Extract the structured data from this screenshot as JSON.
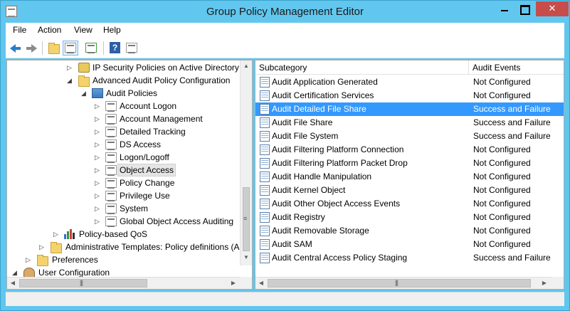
{
  "window": {
    "title": "Group Policy Management Editor",
    "accent_color": "#5fc6ee",
    "close_label": "✕"
  },
  "menubar": {
    "items": [
      {
        "label": "File"
      },
      {
        "label": "Action"
      },
      {
        "label": "View"
      },
      {
        "label": "Help"
      }
    ]
  },
  "toolbar": {
    "buttons": [
      "back-icon",
      "forward-icon",
      "up-folder-icon",
      "show-hide-tree-icon",
      "export-list-icon",
      "help-icon",
      "properties-icon"
    ]
  },
  "tree": {
    "nodes": [
      {
        "label": "IP Security Policies on Active Directory",
        "icon": "lock-icon",
        "toggle": "▷"
      },
      {
        "label": "Advanced Audit Policy Configuration",
        "icon": "folder-icon",
        "toggle": "◢"
      },
      {
        "label": "Audit Policies",
        "icon": "audit-icon",
        "toggle": "◢"
      },
      {
        "label": "Account Logon",
        "icon": "list-icon",
        "toggle": "▷"
      },
      {
        "label": "Account Management",
        "icon": "list-icon",
        "toggle": "▷"
      },
      {
        "label": "Detailed Tracking",
        "icon": "list-icon",
        "toggle": "▷"
      },
      {
        "label": "DS Access",
        "icon": "list-icon",
        "toggle": "▷"
      },
      {
        "label": "Logon/Logoff",
        "icon": "list-icon",
        "toggle": "▷"
      },
      {
        "label": "Object Access",
        "icon": "list-icon",
        "toggle": "▷"
      },
      {
        "label": "Policy Change",
        "icon": "list-icon",
        "toggle": "▷"
      },
      {
        "label": "Privilege Use",
        "icon": "list-icon",
        "toggle": "▷"
      },
      {
        "label": "System",
        "icon": "list-icon",
        "toggle": "▷"
      },
      {
        "label": "Global Object Access Auditing",
        "icon": "list-icon",
        "toggle": "▷"
      },
      {
        "label": "Policy-based QoS",
        "icon": "chart-icon",
        "toggle": "▷"
      },
      {
        "label": "Administrative Templates: Policy definitions (A",
        "icon": "folder-icon",
        "toggle": "▷"
      },
      {
        "label": "Preferences",
        "icon": "folder-icon",
        "toggle": "▷"
      },
      {
        "label": "User Configuration",
        "icon": "user-icon",
        "toggle": "◢"
      }
    ],
    "selected": "Object Access"
  },
  "list": {
    "columns": {
      "subcategory": "Subcategory",
      "audit_events": "Audit Events"
    },
    "rows": [
      {
        "subcategory": "Audit Application Generated",
        "audit_events": "Not Configured"
      },
      {
        "subcategory": "Audit Certification Services",
        "audit_events": "Not Configured"
      },
      {
        "subcategory": "Audit Detailed File Share",
        "audit_events": "Success and Failure"
      },
      {
        "subcategory": "Audit File Share",
        "audit_events": "Success and Failure"
      },
      {
        "subcategory": "Audit File System",
        "audit_events": "Success and Failure"
      },
      {
        "subcategory": "Audit Filtering Platform Connection",
        "audit_events": "Not Configured"
      },
      {
        "subcategory": "Audit Filtering Platform Packet Drop",
        "audit_events": "Not Configured"
      },
      {
        "subcategory": "Audit Handle Manipulation",
        "audit_events": "Not Configured"
      },
      {
        "subcategory": "Audit Kernel Object",
        "audit_events": "Not Configured"
      },
      {
        "subcategory": "Audit Other Object Access Events",
        "audit_events": "Not Configured"
      },
      {
        "subcategory": "Audit Registry",
        "audit_events": "Not Configured"
      },
      {
        "subcategory": "Audit Removable Storage",
        "audit_events": "Not Configured"
      },
      {
        "subcategory": "Audit SAM",
        "audit_events": "Not Configured"
      },
      {
        "subcategory": "Audit Central Access Policy Staging",
        "audit_events": "Success and Failure"
      }
    ],
    "selected": "Audit Detailed File Share",
    "selection_color": "#3399ff"
  },
  "statusbar": {
    "text": ""
  }
}
